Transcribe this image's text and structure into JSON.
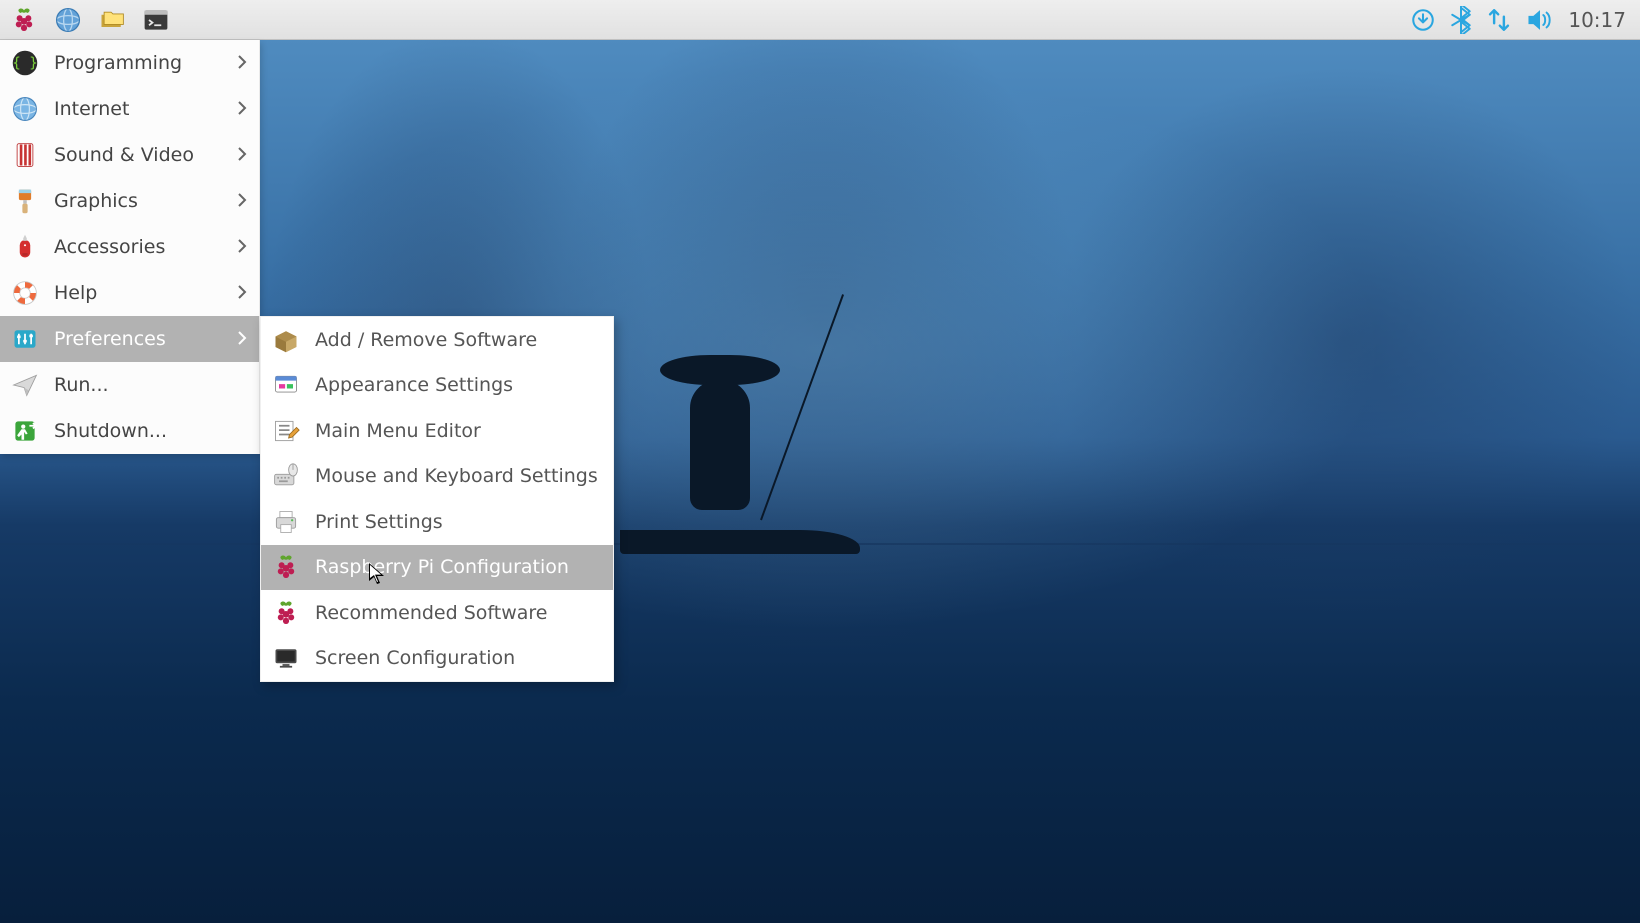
{
  "taskbar": {
    "clock": "10:17"
  },
  "menu": {
    "items": [
      {
        "label": "Programming",
        "icon": "code",
        "arrow": true
      },
      {
        "label": "Internet",
        "icon": "globe",
        "arrow": true
      },
      {
        "label": "Sound & Video",
        "icon": "media",
        "arrow": true
      },
      {
        "label": "Graphics",
        "icon": "brush",
        "arrow": true
      },
      {
        "label": "Accessories",
        "icon": "swissknife",
        "arrow": true
      },
      {
        "label": "Help",
        "icon": "lifebuoy",
        "arrow": true
      },
      {
        "label": "Preferences",
        "icon": "sliders",
        "arrow": true,
        "highlight": true
      },
      {
        "label": "Run...",
        "icon": "paperplane",
        "arrow": false
      },
      {
        "label": "Shutdown...",
        "icon": "exit",
        "arrow": false
      }
    ]
  },
  "submenu": {
    "items": [
      {
        "label": "Add / Remove Software",
        "icon": "package"
      },
      {
        "label": "Appearance Settings",
        "icon": "appearance"
      },
      {
        "label": "Main Menu Editor",
        "icon": "menueditor"
      },
      {
        "label": "Mouse and Keyboard Settings",
        "icon": "mousekbd"
      },
      {
        "label": "Print Settings",
        "icon": "printer"
      },
      {
        "label": "Raspberry Pi Configuration",
        "icon": "raspberry",
        "highlight": true
      },
      {
        "label": "Recommended Software",
        "icon": "raspberry"
      },
      {
        "label": "Screen Configuration",
        "icon": "monitor"
      }
    ]
  }
}
